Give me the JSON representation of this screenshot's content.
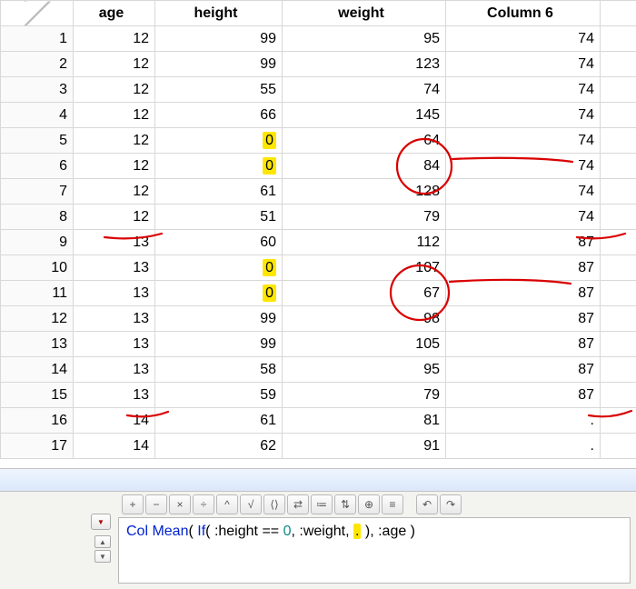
{
  "columns": {
    "row": "",
    "age": "age",
    "height": "height",
    "weight": "weight",
    "col6": "Column 6"
  },
  "rows": [
    {
      "n": 1,
      "age": 12,
      "height": "99",
      "hl_h": false,
      "weight": 95,
      "col6": "74"
    },
    {
      "n": 2,
      "age": 12,
      "height": "99",
      "hl_h": false,
      "weight": 123,
      "col6": "74"
    },
    {
      "n": 3,
      "age": 12,
      "height": "55",
      "hl_h": false,
      "weight": 74,
      "col6": "74"
    },
    {
      "n": 4,
      "age": 12,
      "height": "66",
      "hl_h": false,
      "weight": 145,
      "col6": "74"
    },
    {
      "n": 5,
      "age": 12,
      "height": "0",
      "hl_h": true,
      "weight": 64,
      "col6": "74"
    },
    {
      "n": 6,
      "age": 12,
      "height": "0",
      "hl_h": true,
      "weight": 84,
      "col6": "74"
    },
    {
      "n": 7,
      "age": 12,
      "height": "61",
      "hl_h": false,
      "weight": 128,
      "col6": "74"
    },
    {
      "n": 8,
      "age": 12,
      "height": "51",
      "hl_h": false,
      "weight": 79,
      "col6": "74"
    },
    {
      "n": 9,
      "age": 13,
      "height": "60",
      "hl_h": false,
      "weight": 112,
      "col6": "87"
    },
    {
      "n": 10,
      "age": 13,
      "height": "0",
      "hl_h": true,
      "weight": 107,
      "col6": "87"
    },
    {
      "n": 11,
      "age": 13,
      "height": "0",
      "hl_h": true,
      "weight": 67,
      "col6": "87"
    },
    {
      "n": 12,
      "age": 13,
      "height": "99",
      "hl_h": false,
      "weight": 98,
      "col6": "87"
    },
    {
      "n": 13,
      "age": 13,
      "height": "99",
      "hl_h": false,
      "weight": 105,
      "col6": "87"
    },
    {
      "n": 14,
      "age": 13,
      "height": "58",
      "hl_h": false,
      "weight": 95,
      "col6": "87"
    },
    {
      "n": 15,
      "age": 13,
      "height": "59",
      "hl_h": false,
      "weight": 79,
      "col6": "87"
    },
    {
      "n": 16,
      "age": 14,
      "height": "61",
      "hl_h": false,
      "weight": 81,
      "col6": "."
    },
    {
      "n": 17,
      "age": 14,
      "height": "62",
      "hl_h": false,
      "weight": 91,
      "col6": "."
    }
  ],
  "toolbar": {
    "btns": [
      "+",
      "−",
      "×",
      "÷",
      "^",
      "√",
      "⟨⟩",
      "⇄",
      "≔",
      "⇅",
      "⊕",
      "≡",
      "|",
      "↶",
      "↷"
    ]
  },
  "formula": {
    "fn": "Col Mean",
    "kw": "If",
    "colA": ":height",
    "op": "==",
    "num": "0",
    "colB": ":weight",
    "placeholder": ".",
    "colC": ":age"
  },
  "dot": "."
}
